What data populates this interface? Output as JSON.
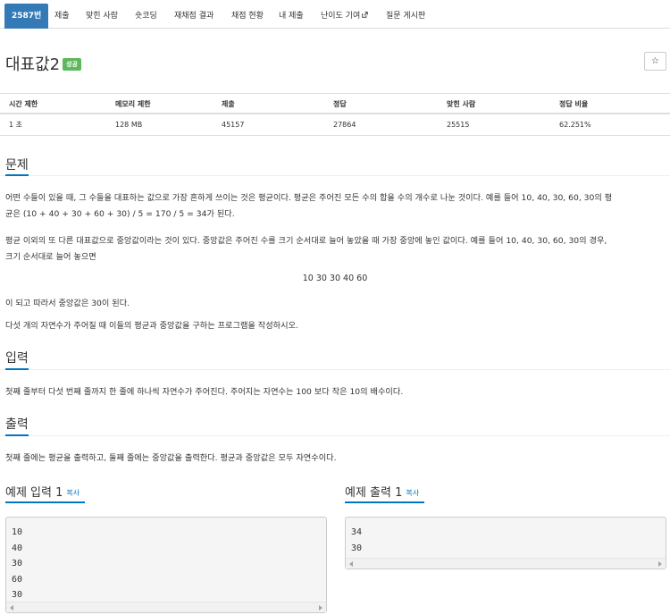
{
  "tabs": [
    {
      "label": "2587번",
      "active": true
    },
    {
      "label": "제출"
    },
    {
      "label": "맞힌 사람"
    },
    {
      "label": "숏코딩"
    },
    {
      "label": "재채점 결과"
    },
    {
      "label": "채점 현황"
    },
    {
      "label": "내 제출"
    },
    {
      "label": "난이도 기여"
    },
    {
      "label": "질문 게시판"
    }
  ],
  "problem": {
    "title": "대표값2",
    "status_badge": "성공",
    "star": "☆"
  },
  "stats": {
    "headers": [
      "시간 제한",
      "메모리 제한",
      "제출",
      "정답",
      "맞힌 사람",
      "정답 비율"
    ],
    "values": [
      "1 초",
      "128 MB",
      "45157",
      "27864",
      "25515",
      "62.251%"
    ]
  },
  "sections": {
    "problem_heading": "문제",
    "problem_p1a": "어떤 수들이 있을 때, 그 수들을 대표하는 값으로 가장 흔하게 쓰이는 것은 평균이다. 평균은 주어진 모든 수의 합을 수의 개수로 나눈 것이다. 예를 들어 10, 40, 30, 60, 30의 평",
    "problem_p1b": "균은 (10 + 40 + 30 + 60 + 30) / 5 = 170 / 5 = 34가 된다.",
    "problem_p2a": "평균 이외의 또 다른 대표값으로 중앙값이라는 것이 있다. 중앙값은 주어진 수를 크기 순서대로 늘어 놓았을 때 가장 중앙에 놓인 값이다. 예를 들어 10, 40, 30, 60, 30의 경우,",
    "problem_p2b": "크기 순서대로 늘어 놓으면",
    "problem_sorted": "10 30 30 40 60",
    "problem_p3": "이 되고 따라서 중앙값은 30이 된다.",
    "problem_p4": "다섯 개의 자연수가 주어질 때 이들의 평균과 중앙값을 구하는 프로그램을 작성하시오.",
    "input_heading": "입력",
    "input_text": "첫째 줄부터 다섯 번째 줄까지 한 줄에 하나씩 자연수가 주어진다. 주어지는 자연수는 100 보다 작은 10의 배수이다.",
    "output_heading": "출력",
    "output_text": "첫째 줄에는 평균을 출력하고, 둘째 줄에는 중앙값을 출력한다. 평균과 중앙값은 모두 자연수이다."
  },
  "samples": {
    "input_title": "예제 입력 1",
    "output_title": "예제 출력 1",
    "copy_label": "복사",
    "input_lines": [
      "10",
      "40",
      "30",
      "60",
      "30"
    ],
    "output_lines": [
      "34",
      "30"
    ]
  },
  "colors": {
    "active_tab": "#337ab7",
    "badge": "#5cb85c",
    "accent": "#0076c0"
  }
}
